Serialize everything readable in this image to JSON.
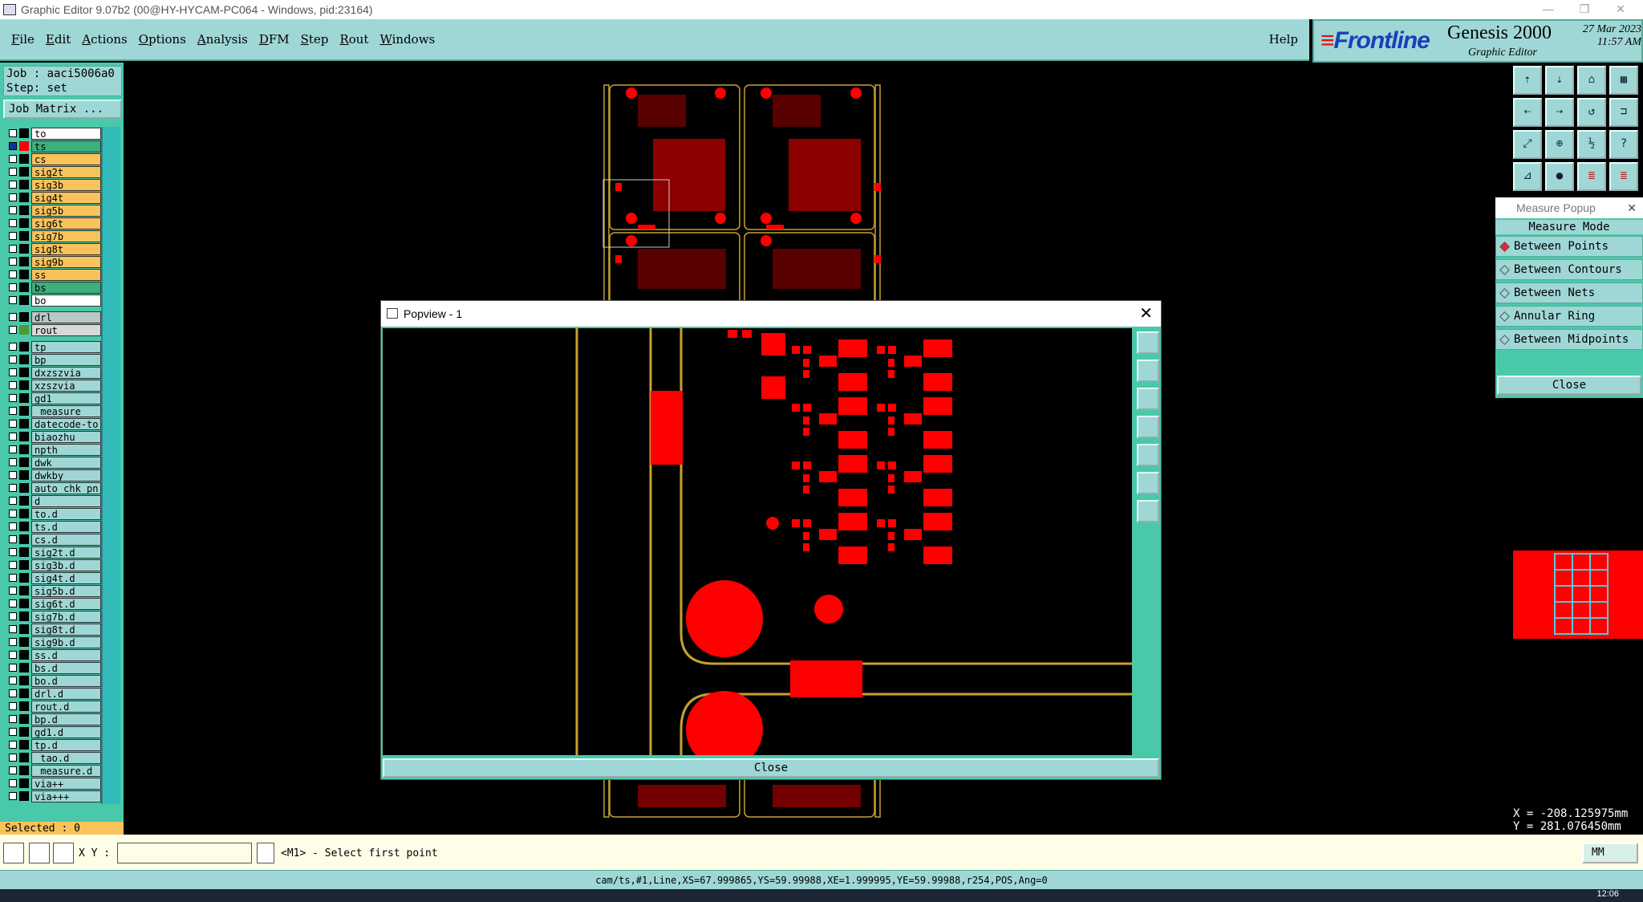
{
  "window": {
    "title": "Graphic Editor 9.07b2 (00@HY-HYCAM-PC064 - Windows, pid:23164)"
  },
  "menu": [
    {
      "label": "File",
      "key": "F",
      "rest": "ile"
    },
    {
      "label": "Edit",
      "key": "E",
      "rest": "dit"
    },
    {
      "label": "Actions",
      "key": "A",
      "rest": "ctions"
    },
    {
      "label": "Options",
      "key": "O",
      "rest": "ptions"
    },
    {
      "label": "Analysis",
      "key": "A",
      "rest": "nalysis"
    },
    {
      "label": "DFM",
      "key": "D",
      "rest": "FM"
    },
    {
      "label": "Step",
      "key": "S",
      "rest": "tep"
    },
    {
      "label": "Rout",
      "key": "R",
      "rest": "out"
    },
    {
      "label": "Windows",
      "key": "W",
      "rest": "indows"
    }
  ],
  "help_label": "Help",
  "brand": {
    "logo_text": "Frontline",
    "product": "Genesis 2000",
    "subtitle": "Graphic Editor",
    "date": "27 Mar 2023",
    "time": "11:57 AM"
  },
  "job": {
    "job_line": "Job : aaci5006a0",
    "step_line": "Step: set",
    "matrix_button": "Job Matrix ..."
  },
  "layers": [
    {
      "name": "to",
      "bg": "#ffffff",
      "swatch": "#000000"
    },
    {
      "name": "ts",
      "bg": "#3ab07c",
      "swatch": "#ff0000",
      "active": true
    },
    {
      "name": "cs",
      "bg": "#f8c35a",
      "swatch": "#000000"
    },
    {
      "name": "sig2t",
      "bg": "#f8c35a",
      "swatch": "#000000"
    },
    {
      "name": "sig3b",
      "bg": "#f8c35a",
      "swatch": "#000000"
    },
    {
      "name": "sig4t",
      "bg": "#f8c35a",
      "swatch": "#000000"
    },
    {
      "name": "sig5b",
      "bg": "#f8c35a",
      "swatch": "#000000"
    },
    {
      "name": "sig6t",
      "bg": "#f8c35a",
      "swatch": "#000000"
    },
    {
      "name": "sig7b",
      "bg": "#f8c35a",
      "swatch": "#000000"
    },
    {
      "name": "sig8t",
      "bg": "#f8c35a",
      "swatch": "#000000"
    },
    {
      "name": "sig9b",
      "bg": "#f8c35a",
      "swatch": "#000000"
    },
    {
      "name": "ss",
      "bg": "#f8c35a",
      "swatch": "#000000"
    },
    {
      "name": "bs",
      "bg": "#3ab07c",
      "swatch": "#000000"
    },
    {
      "name": "bo",
      "bg": "#ffffff",
      "swatch": "#000000",
      "gap_after": true
    },
    {
      "name": "drl",
      "bg": "#b8c8c8",
      "swatch": "#000000"
    },
    {
      "name": "rout",
      "bg": "#d8d8d8",
      "swatch": "#4a9a3a",
      "gap_after": true
    },
    {
      "name": "tp",
      "bg": "#9fd7d6",
      "swatch": "#000000"
    },
    {
      "name": "bp",
      "bg": "#9fd7d6",
      "swatch": "#000000"
    },
    {
      "name": "dxzszvia",
      "bg": "#9fd7d6",
      "swatch": "#000000"
    },
    {
      "name": "xzszvia",
      "bg": "#9fd7d6",
      "swatch": "#000000"
    },
    {
      "name": "gd1",
      "bg": "#9fd7d6",
      "swatch": "#000000"
    },
    {
      "name": "_measure",
      "bg": "#9fd7d6",
      "swatch": "#000000"
    },
    {
      "name": "datecode-to",
      "bg": "#9fd7d6",
      "swatch": "#000000"
    },
    {
      "name": "biaozhu",
      "bg": "#9fd7d6",
      "swatch": "#000000"
    },
    {
      "name": "npth",
      "bg": "#9fd7d6",
      "swatch": "#000000"
    },
    {
      "name": "dwk",
      "bg": "#9fd7d6",
      "swatch": "#000000"
    },
    {
      "name": "dwkby",
      "bg": "#9fd7d6",
      "swatch": "#000000"
    },
    {
      "name": "auto_chk_pn",
      "bg": "#9fd7d6",
      "swatch": "#000000"
    },
    {
      "name": "d",
      "bg": "#9fd7d6",
      "swatch": "#000000"
    },
    {
      "name": "to.d",
      "bg": "#9fd7d6",
      "swatch": "#000000"
    },
    {
      "name": "ts.d",
      "bg": "#9fd7d6",
      "swatch": "#000000"
    },
    {
      "name": "cs.d",
      "bg": "#9fd7d6",
      "swatch": "#000000"
    },
    {
      "name": "sig2t.d",
      "bg": "#9fd7d6",
      "swatch": "#000000"
    },
    {
      "name": "sig3b.d",
      "bg": "#9fd7d6",
      "swatch": "#000000"
    },
    {
      "name": "sig4t.d",
      "bg": "#9fd7d6",
      "swatch": "#000000"
    },
    {
      "name": "sig5b.d",
      "bg": "#9fd7d6",
      "swatch": "#000000"
    },
    {
      "name": "sig6t.d",
      "bg": "#9fd7d6",
      "swatch": "#000000"
    },
    {
      "name": "sig7b.d",
      "bg": "#9fd7d6",
      "swatch": "#000000"
    },
    {
      "name": "sig8t.d",
      "bg": "#9fd7d6",
      "swatch": "#000000"
    },
    {
      "name": "sig9b.d",
      "bg": "#9fd7d6",
      "swatch": "#000000"
    },
    {
      "name": "ss.d",
      "bg": "#9fd7d6",
      "swatch": "#000000"
    },
    {
      "name": "bs.d",
      "bg": "#9fd7d6",
      "swatch": "#000000"
    },
    {
      "name": "bo.d",
      "bg": "#9fd7d6",
      "swatch": "#000000"
    },
    {
      "name": "drl.d",
      "bg": "#9fd7d6",
      "swatch": "#000000"
    },
    {
      "name": "rout.d",
      "bg": "#9fd7d6",
      "swatch": "#000000"
    },
    {
      "name": "bp.d",
      "bg": "#9fd7d6",
      "swatch": "#000000"
    },
    {
      "name": "gd1.d",
      "bg": "#9fd7d6",
      "swatch": "#000000"
    },
    {
      "name": "tp.d",
      "bg": "#9fd7d6",
      "swatch": "#000000"
    },
    {
      "name": "_tao.d",
      "bg": "#9fd7d6",
      "swatch": "#000000"
    },
    {
      "name": "_measure.d",
      "bg": "#9fd7d6",
      "swatch": "#000000"
    },
    {
      "name": "via++",
      "bg": "#9fd7d6",
      "swatch": "#000000"
    },
    {
      "name": "via+++",
      "bg": "#9fd7d6",
      "swatch": "#000000"
    }
  ],
  "selected_label": "Selected : 0",
  "measure": {
    "title": "Measure Popup",
    "heading": "Measure Mode",
    "options": [
      {
        "label": "Between Points",
        "on": true
      },
      {
        "label": "Between Contours",
        "on": false
      },
      {
        "label": "Between Nets",
        "on": false
      },
      {
        "label": "Annular Ring",
        "on": false
      },
      {
        "label": "Between Midpoints",
        "on": false
      }
    ],
    "close_label": "Close"
  },
  "coords": {
    "x": "X = -208.125975mm",
    "y": "Y = 281.076450mm"
  },
  "popview": {
    "title": "Popview - 1",
    "close_label": "Close"
  },
  "status": {
    "xy_label": "X Y :",
    "xy_value": "",
    "prompt": "<M1> - Select first point",
    "units": "MM"
  },
  "info": "cam/ts,#1,Line,XS=67.999865,YS=59.99988,XE=1.999995,YE=59.99988,r254,POS,Ang=0",
  "taskbar": {
    "clock": "12:06"
  },
  "colors": {
    "panel": "#9fd7d6",
    "panel_dark": "#49c9a9",
    "copper": "#ff0000",
    "outline": "#c8a030",
    "status_bg": "#fffde8"
  },
  "icons": [
    "app-icon",
    "minimize-icon",
    "restore-icon",
    "close-icon",
    "zoom-home-icon",
    "zoom-in-icon",
    "zoom-out-icon",
    "pan-left-icon",
    "pan-right-icon",
    "fit-icon",
    "help-icon"
  ]
}
